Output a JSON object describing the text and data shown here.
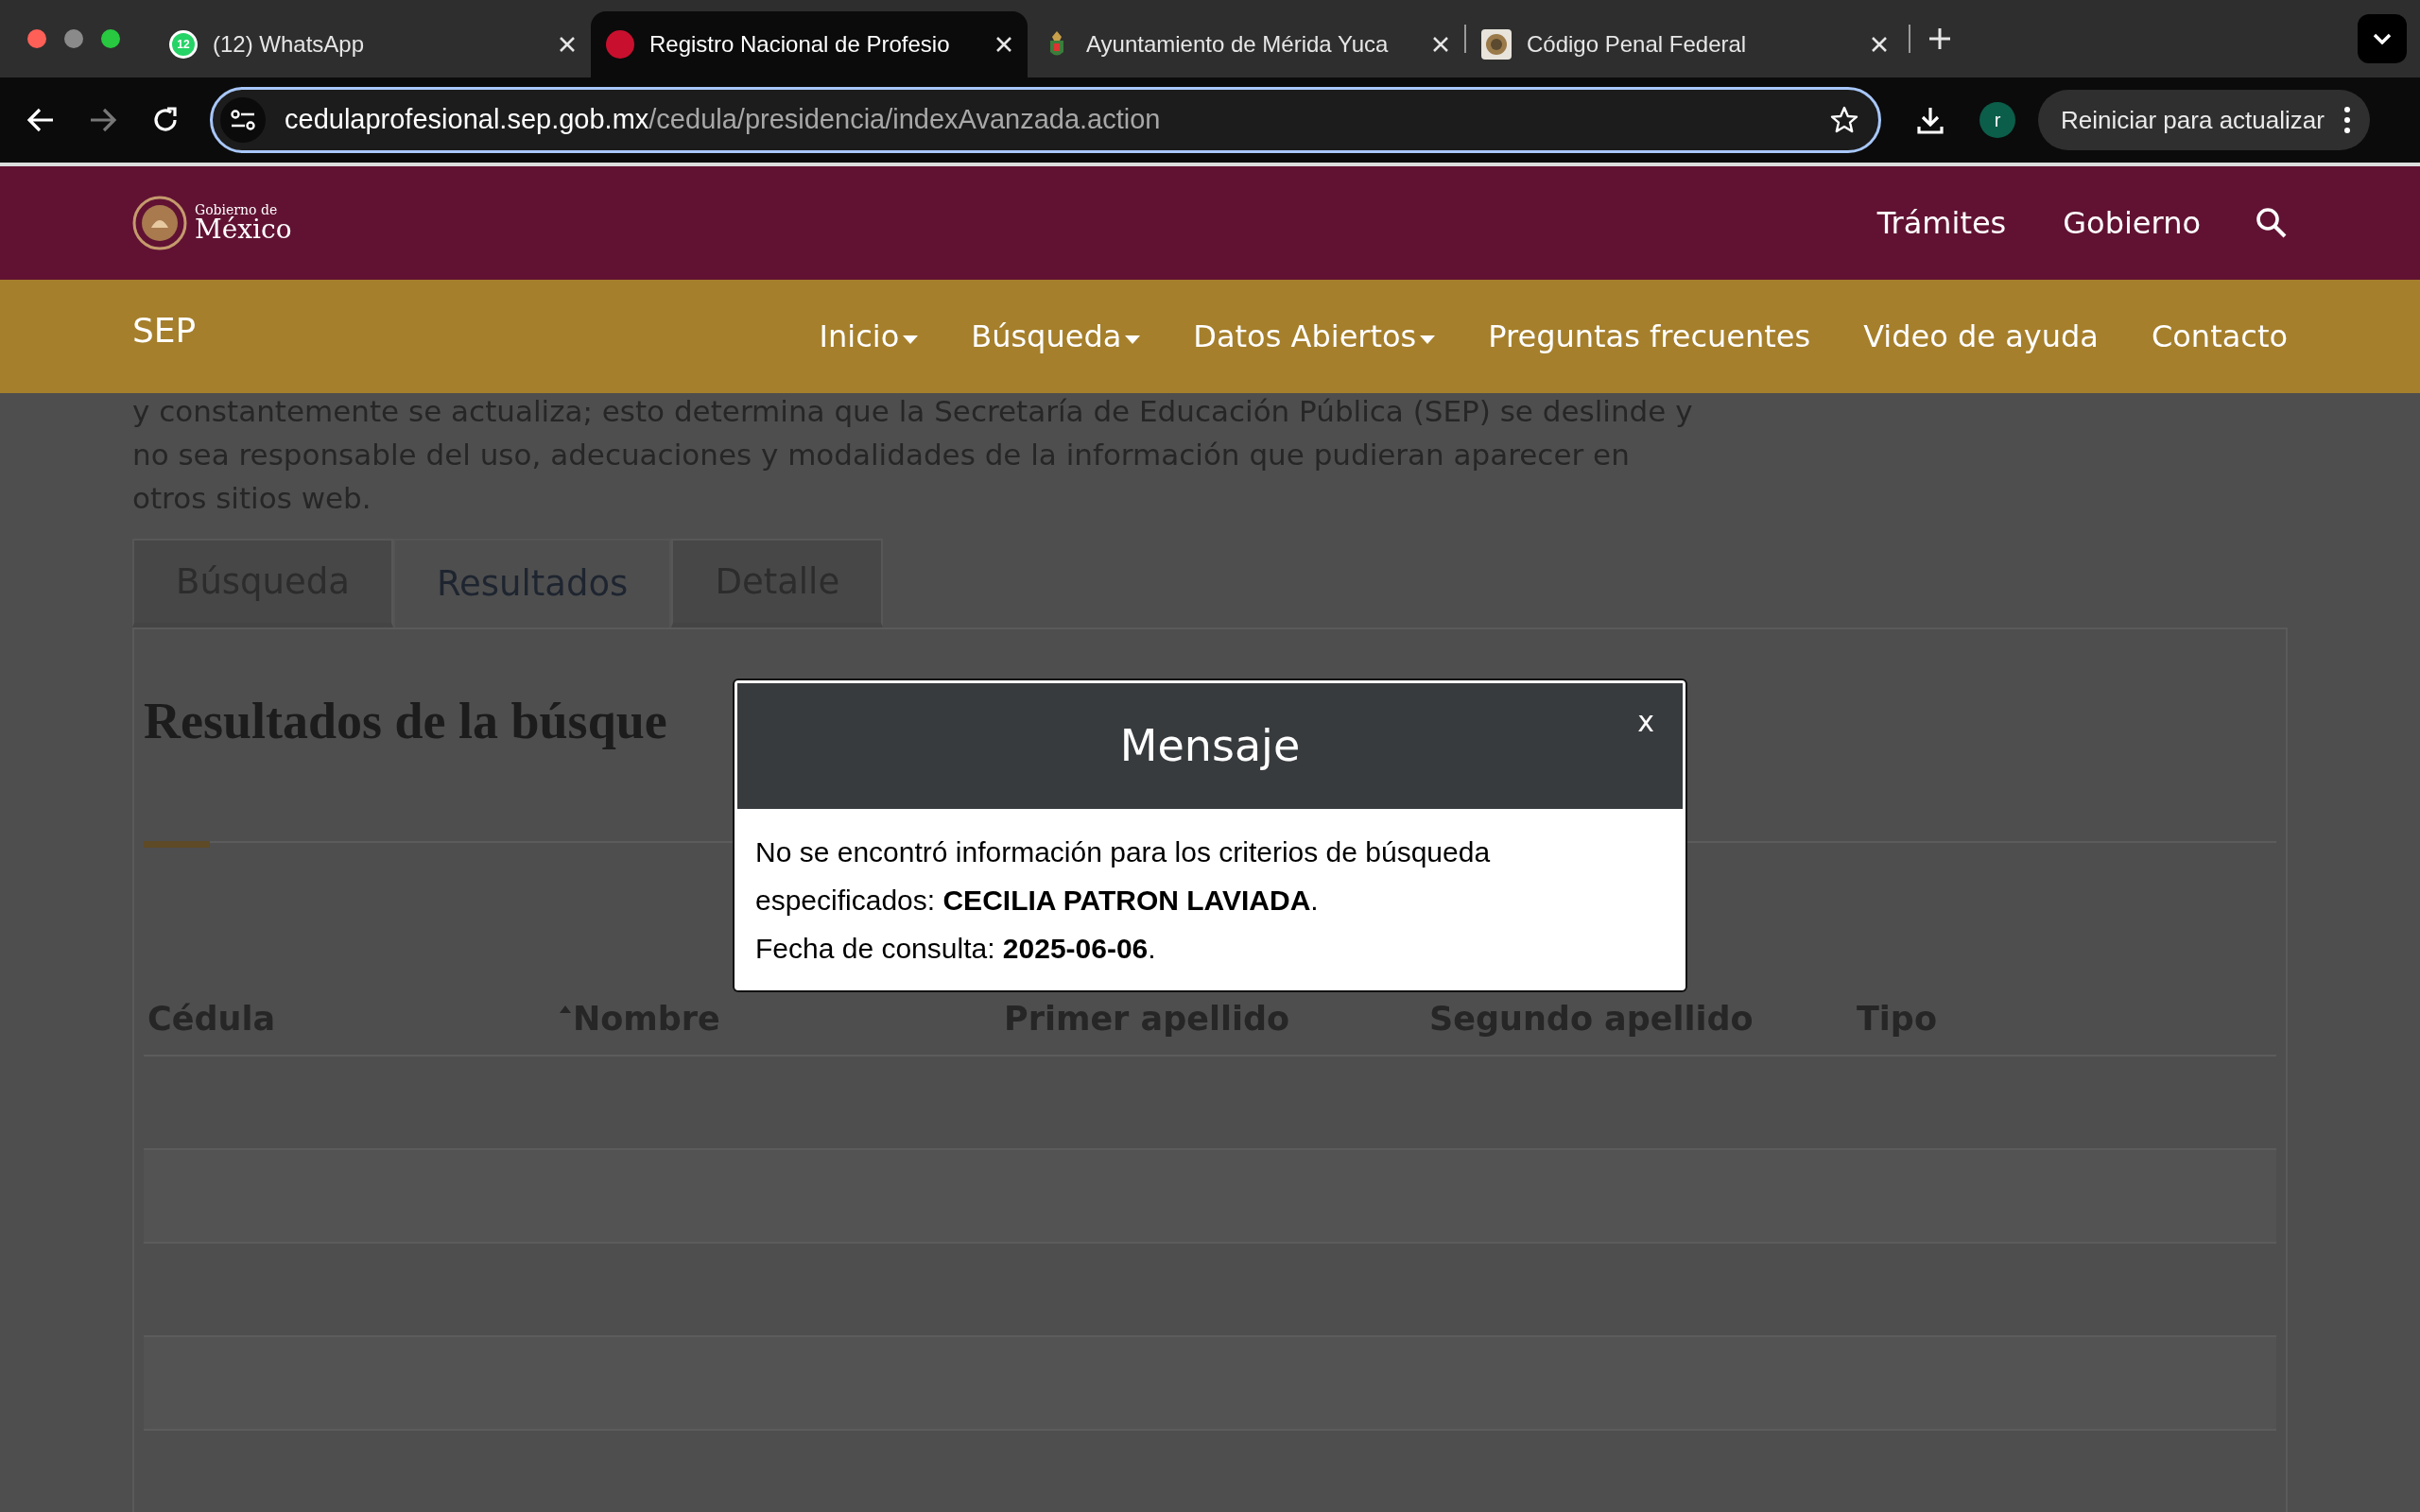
{
  "browser": {
    "tabs": [
      {
        "title": "(12) WhatsApp",
        "selected": false,
        "kind": "chat",
        "favicon_badge": "12"
      },
      {
        "title": "Registro Nacional de Profesio",
        "selected": true,
        "kind": "dot"
      },
      {
        "title": "Ayuntamiento de Mérida Yuca",
        "selected": false,
        "kind": "crest"
      },
      {
        "title": "Código Penal Federal",
        "selected": false,
        "kind": "seal"
      }
    ],
    "url_domain": "cedulaprofesional.sep.gob.mx",
    "url_path": "/cedula/presidencia/indexAvanzada.action",
    "profile_initial": "r",
    "update_button": "Reiniciar para actualizar"
  },
  "gov_header": {
    "logo_small": "Gobierno de",
    "logo_large": "México",
    "links": [
      "Trámites",
      "Gobierno"
    ]
  },
  "site_nav": {
    "brand": "SEP",
    "items": [
      {
        "label": "Inicio",
        "dropdown": true
      },
      {
        "label": "Búsqueda",
        "dropdown": true
      },
      {
        "label": "Datos Abiertos",
        "dropdown": true
      },
      {
        "label": "Preguntas frecuentes",
        "dropdown": false
      },
      {
        "label": "Video de ayuda",
        "dropdown": false
      },
      {
        "label": "Contacto",
        "dropdown": false
      }
    ]
  },
  "disclaimer": "y constantemente se actualiza; esto determina que la Secretaría de Educación Pública (SEP) se deslinde y no sea responsable del uso, adecuaciones y modalidades de la información que pudieran aparecer en otros sitios web.",
  "page_tabs": [
    {
      "label": "Búsqueda",
      "selected": false
    },
    {
      "label": "Resultados",
      "selected": true
    },
    {
      "label": "Detalle",
      "selected": false
    }
  ],
  "results": {
    "heading": "Resultados de la búsque",
    "columns": [
      {
        "label": "Cédula",
        "sorted": false
      },
      {
        "label": "Nombre",
        "sorted": true
      },
      {
        "label": "Primer apellido",
        "sorted": false
      },
      {
        "label": "Segundo apellido",
        "sorted": false
      },
      {
        "label": "Tipo",
        "sorted": false
      }
    ]
  },
  "dialog": {
    "title": "Mensaje",
    "close": "x",
    "message": "No se encontró información para los criterios de búsqueda especificados: **CECILIA PATRON LAVIADA**.",
    "date_line": "Fecha de consulta: **2025-06-06**."
  }
}
